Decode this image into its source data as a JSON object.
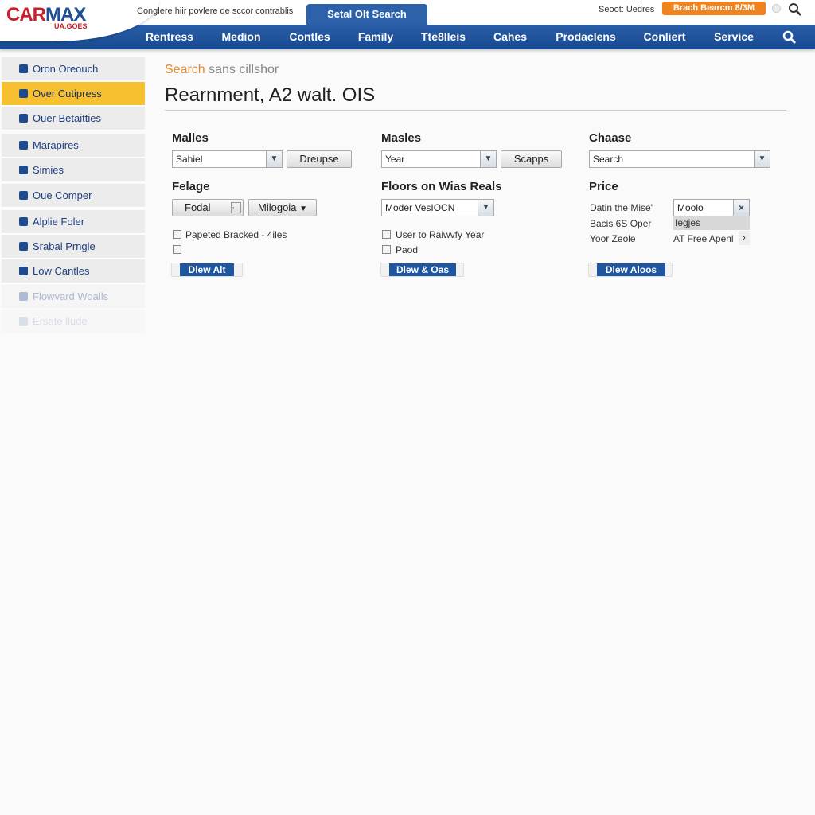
{
  "header": {
    "logo": "CARMAX",
    "logo_car": "CAR",
    "logo_max": "MAX",
    "logo_sub": "UA.GOES",
    "tagline": "Conglere hiir povlere de sccor contrablis",
    "active_tab": "Setal Olt Search",
    "updates": "Seoot: Uedres",
    "orange_button": "Brach Bearcm 8/3M"
  },
  "nav": {
    "items": [
      "Rentress",
      "Medion",
      "Contles",
      "Family",
      "Tte8lleis",
      "Cahes",
      "Prodaclens",
      "Conliert",
      "Service"
    ]
  },
  "sidebar": {
    "items": [
      {
        "label": "Oron Oreouch",
        "icon": "tag-icon"
      },
      {
        "label": "Over Cutipress",
        "icon": "document-icon",
        "active": true
      },
      {
        "label": "Ouer Betaitties",
        "icon": "calendar-icon"
      },
      {
        "label": "Marapires",
        "icon": "thumb-icon"
      },
      {
        "label": "Simies",
        "icon": "binoculars-icon"
      },
      {
        "label": "Oue Comper",
        "icon": "print-icon"
      },
      {
        "label": "Alplie Foler",
        "icon": "lock-icon"
      },
      {
        "label": "Srabal Prngle",
        "icon": "search-icon"
      },
      {
        "label": "Low Cantles",
        "icon": "car-icon"
      },
      {
        "label": "Flowvard Woalls",
        "icon": "mail-icon"
      },
      {
        "label": "Ersate llude",
        "icon": "car-icon"
      }
    ]
  },
  "main": {
    "breadcrumb_highlight": "Search",
    "breadcrumb_rest": "sans cillshor",
    "title": "Rearnment, A2 walt. OIS",
    "col1": {
      "label1": "Malles",
      "select1": "Sahiel",
      "button1": "Dreupse",
      "label2": "Felage",
      "button2": "Fodal",
      "dropdown2": "Milogoia",
      "checkbox1": "Papeted Bracked - 4iles",
      "action": "Dlew Alt"
    },
    "col2": {
      "label1": "Masles",
      "select1": "Year",
      "button1": "Scapps",
      "label2": "Floors on Wias Reals",
      "select2": "Moder VesIOCN",
      "checkbox1": "User to Raiwvfy Year",
      "checkbox2": "Paod",
      "action": "Dlew & Oas"
    },
    "col3": {
      "label1": "Chaase",
      "select1": "Search",
      "label2": "Price",
      "row1_label": "Datin the Mise'",
      "row1_value": "Moolo",
      "row2_label": "Bacis 6S Oper",
      "row2_value": "Iegjes",
      "row3_label": "Yoor Zeole",
      "row3_value": "AT Free Apenl",
      "action": "Dlew Aloos"
    }
  },
  "colors": {
    "nav_blue": "#1c4f96",
    "accent_orange": "#ee8420",
    "active_yellow": "#f7c030",
    "brand_red": "#c8202a"
  }
}
